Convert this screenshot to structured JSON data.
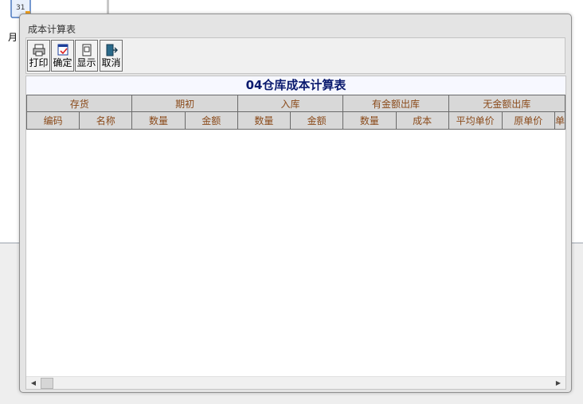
{
  "desktop": {
    "label": "月"
  },
  "window": {
    "title": "成本计算表"
  },
  "toolbar": {
    "print_label": "打印",
    "confirm_label": "确定",
    "show_label": "显示",
    "cancel_label": "取消"
  },
  "report": {
    "title": "04仓库成本计算表",
    "groups": [
      "存货",
      "期初",
      "入库",
      "有金额出库",
      "无金额出库"
    ],
    "columns": [
      "编码",
      "名称",
      "数量",
      "金额",
      "数量",
      "金额",
      "数量",
      "成本",
      "平均单价",
      "原单价",
      "单"
    ]
  },
  "colors": {
    "header_text": "#8a4a1a",
    "title_text": "#0a1a6e"
  }
}
